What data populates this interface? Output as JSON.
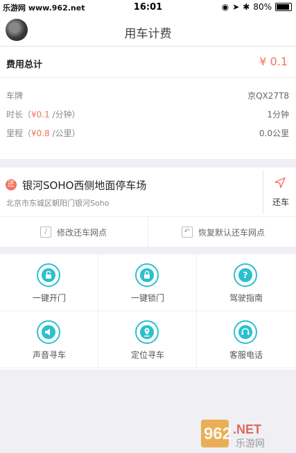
{
  "status_bar": {
    "watermark": "乐游网 www.962.net",
    "time": "16:01",
    "battery": "80%"
  },
  "header": {
    "title": "用车计费"
  },
  "fee": {
    "total_label": "费用总计",
    "total_value": "¥ 0.1",
    "plate_label": "车牌",
    "plate_value": "京QX27T8",
    "duration_label_pre": "时长（",
    "duration_rate": "¥0.1",
    "duration_label_post": " /分钟）",
    "duration_value": "1分钟",
    "distance_label_pre": "里程（",
    "distance_rate": "¥0.8",
    "distance_label_post": " /公里）",
    "distance_value": "0.0公里"
  },
  "station": {
    "badge": "还",
    "name": "银河SOHO西侧地面停车场",
    "address": "北京市东城区朝阳门银河Soho",
    "return_label": "还车",
    "modify_label": "修改还车网点",
    "restore_label": "恢复默认还车网点"
  },
  "actions": [
    {
      "label": "一键开门",
      "icon": "unlock-icon"
    },
    {
      "label": "一键锁门",
      "icon": "lock-icon"
    },
    {
      "label": "驾驶指南",
      "icon": "question-icon",
      "glyph": "?"
    },
    {
      "label": "声音寻车",
      "icon": "speaker-icon"
    },
    {
      "label": "定位寻车",
      "icon": "location-icon"
    },
    {
      "label": "客服电话",
      "icon": "headset-icon"
    }
  ],
  "watermark": {
    "brand": "962",
    "suffix": ".NET",
    "site": "乐游网"
  },
  "colors": {
    "accent": "#2bc0cf",
    "price": "#f3735b"
  }
}
